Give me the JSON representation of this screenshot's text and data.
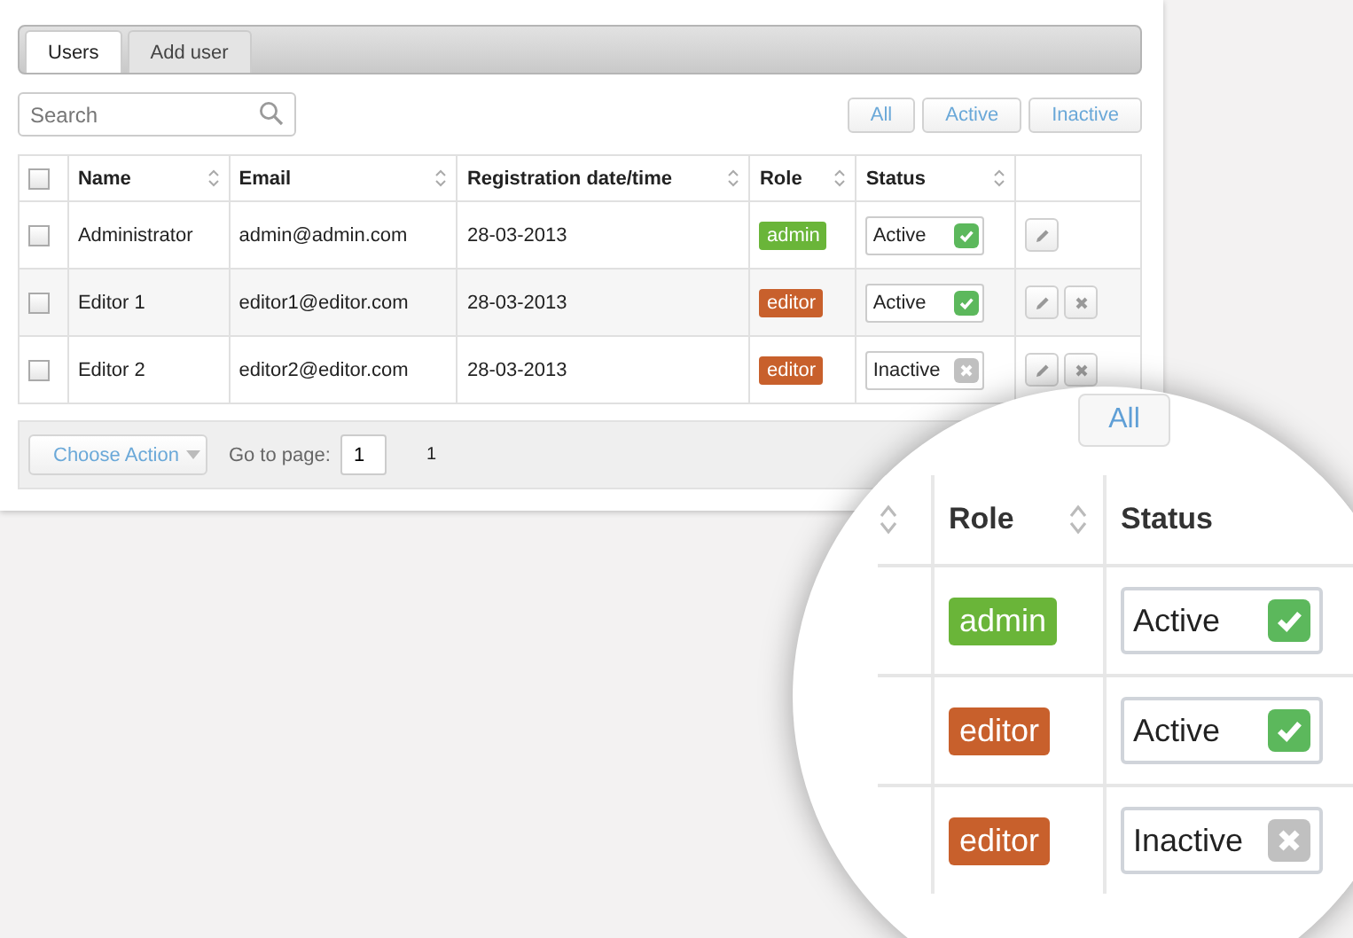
{
  "tabs": [
    {
      "label": "Users",
      "selected": true
    },
    {
      "label": "Add user",
      "selected": false
    }
  ],
  "search": {
    "placeholder": "Search"
  },
  "filters": [
    {
      "label": "All"
    },
    {
      "label": "Active"
    },
    {
      "label": "Inactive"
    }
  ],
  "table": {
    "select_all_checked": false,
    "columns": [
      "Name",
      "Email",
      "Registration date/time",
      "Role",
      "Status"
    ],
    "rows": [
      {
        "checked": false,
        "name": "Administrator",
        "email": "admin@admin.com",
        "date": "28-03-2013",
        "role": "admin",
        "color": "#6ab539",
        "status": "Active",
        "active": true,
        "deletable": false
      },
      {
        "checked": false,
        "name": "Editor 1",
        "email": "editor1@editor.com",
        "date": "28-03-2013",
        "role": "editor",
        "color": "#c8602c",
        "status": "Active",
        "active": true,
        "deletable": true
      },
      {
        "checked": false,
        "name": "Editor 2",
        "email": "editor2@editor.com",
        "date": "28-03-2013",
        "role": "editor",
        "color": "#c8602c",
        "status": "Inactive",
        "active": false,
        "deletable": true
      }
    ]
  },
  "footer": {
    "action_label": "Choose Action",
    "goto_label": "Go to page:",
    "page_value": "1",
    "page_link": "1"
  },
  "magnifier": {
    "filter_label": "All",
    "columns": [
      "Role",
      "Status"
    ],
    "rows": [
      {
        "role": "admin",
        "color": "#6ab539",
        "status": "Active",
        "active": true
      },
      {
        "role": "editor",
        "color": "#c8602c",
        "status": "Active",
        "active": true
      },
      {
        "role": "editor",
        "color": "#c8602c",
        "status": "Inactive",
        "active": false
      }
    ]
  }
}
